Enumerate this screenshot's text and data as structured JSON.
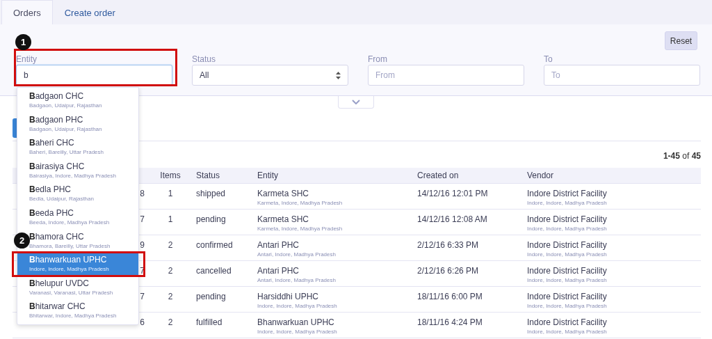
{
  "tabs": [
    {
      "label": "Orders",
      "selected": true
    },
    {
      "label": "Create order",
      "selected": false
    }
  ],
  "filters": {
    "reset": "Reset",
    "fields": [
      {
        "kind": "text",
        "label": "Entity",
        "value": "b",
        "focused": true
      },
      {
        "kind": "select",
        "label": "Status",
        "value": "All",
        "focused": false
      },
      {
        "kind": "text",
        "label": "From",
        "placeholder": "From",
        "focused": false
      },
      {
        "kind": "text",
        "label": "To",
        "placeholder": "To",
        "focused": false
      }
    ]
  },
  "suggestions": [
    {
      "name": "**B**adgaon CHC",
      "location": "Badgaon, Udaipur, Rajasthan",
      "selected": false
    },
    {
      "name": "**B**adgaon PHC",
      "location": "Badgaon, Udaipur, Rajasthan",
      "selected": false
    },
    {
      "name": "**B**aheri CHC",
      "location": "Baheri, Bareilly, Uttar Pradesh",
      "selected": false
    },
    {
      "name": "**B**airasiya CHC",
      "location": "Bairasiya, Indore, Madhya Pradesh",
      "selected": false
    },
    {
      "name": "**B**edla PHC",
      "location": "Bedla, Udaipur, Rajasthan",
      "selected": false
    },
    {
      "name": "**B**eeda PHC",
      "location": "Beeda, Indore, Madhya Pradesh",
      "selected": false
    },
    {
      "name": "**B**hamora CHC",
      "location": "Bhamora, Bareilly, Uttar Pradesh",
      "selected": false
    },
    {
      "name": "**B**hanwarkuan UPHC",
      "location": "Indore, Indore, Madhya Pradesh",
      "selected": true
    },
    {
      "name": "**B**helupur UVDC",
      "location": "Varanasi, Varanasi, Uttar Pradesh",
      "selected": false
    },
    {
      "name": "**B**hitarwar CHC",
      "location": "Bhitarwar, Indore, Madhya Pradesh",
      "selected": false
    }
  ],
  "count": "**1-45** of **45**",
  "table": {
    "columns": [
      "Items",
      "Status",
      "Entity",
      "Created on",
      "Vendor"
    ],
    "rows": [
      {
        "column_1": "8",
        "items": "1",
        "status": "shipped",
        "entity": "Karmeta SHC",
        "entity_location": "Karmeta, Indore, Madhya Pradesh",
        "created_on": "14/12/16 12:01 PM",
        "vendor": "Indore District Facility",
        "vendor_location": "Indore, Indore, Madhya Pradesh"
      },
      {
        "column_1": "7",
        "items": "1",
        "status": "pending",
        "entity": "Karmeta SHC",
        "entity_location": "Karmeta, Indore, Madhya Pradesh",
        "created_on": "14/12/16 12:08 AM",
        "vendor": "Indore District Facility",
        "vendor_location": "Indore, Indore, Madhya Pradesh"
      },
      {
        "column_1": "9",
        "items": "2",
        "status": "confirmed",
        "entity": "Antari PHC",
        "entity_location": "Antari, Indore, Madhya Pradesh",
        "created_on": "2/12/16 6:33 PM",
        "vendor": "Indore District Facility",
        "vendor_location": "Indore, Indore, Madhya Pradesh"
      },
      {
        "column_1": "7",
        "items": "2",
        "status": "cancelled",
        "entity": "Antari PHC",
        "entity_location": "Antari, Indore, Madhya Pradesh",
        "created_on": "2/12/16 6:26 PM",
        "vendor": "Indore District Facility",
        "vendor_location": "Indore, Indore, Madhya Pradesh"
      },
      {
        "column_1": "7",
        "items": "2",
        "status": "pending",
        "entity": "Harsiddhi UPHC",
        "entity_location": "Indore, Indore, Madhya Pradesh",
        "created_on": "18/11/16 6:00 PM",
        "vendor": "Indore District Facility",
        "vendor_location": "Indore, Indore, Madhya Pradesh"
      },
      {
        "column_1": "6",
        "items": "2",
        "status": "fulfilled",
        "entity": "Bhanwarkuan UPHC",
        "entity_location": "Indore, Indore, Madhya Pradesh",
        "created_on": "18/11/16 4:24 PM",
        "vendor": "Indore District Facility",
        "vendor_location": "Indore, Indore, Madhya Pradesh"
      }
    ]
  },
  "annotations": [
    {
      "label": "1"
    },
    {
      "label": "2"
    }
  ]
}
